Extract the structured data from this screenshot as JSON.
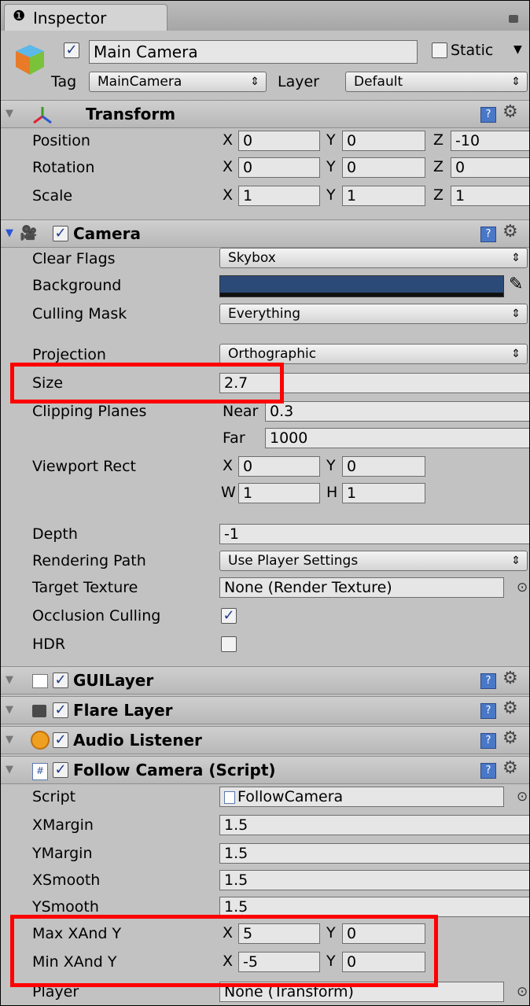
{
  "tab": {
    "title": "Inspector"
  },
  "object": {
    "name": "Main Camera",
    "static_label": "Static",
    "tag_label": "Tag",
    "tag_value": "MainCamera",
    "layer_label": "Layer",
    "layer_value": "Default"
  },
  "transform": {
    "title": "Transform",
    "rows": [
      {
        "label": "Position",
        "x": "0",
        "y": "0",
        "z": "-10"
      },
      {
        "label": "Rotation",
        "x": "0",
        "y": "0",
        "z": "0"
      },
      {
        "label": "Scale",
        "x": "1",
        "y": "1",
        "z": "1"
      }
    ]
  },
  "axes": {
    "x": "X",
    "y": "Y",
    "z": "Z",
    "w": "W",
    "h": "H"
  },
  "camera": {
    "title": "Camera",
    "clear_flags": {
      "label": "Clear Flags",
      "value": "Skybox"
    },
    "background": {
      "label": "Background",
      "color": "#2c4a78"
    },
    "culling_mask": {
      "label": "Culling Mask",
      "value": "Everything"
    },
    "projection": {
      "label": "Projection",
      "value": "Orthographic"
    },
    "size": {
      "label": "Size",
      "value": "2.7"
    },
    "clipping": {
      "label": "Clipping Planes",
      "near_label": "Near",
      "near": "0.3",
      "far_label": "Far",
      "far": "1000"
    },
    "viewport": {
      "label": "Viewport Rect",
      "x": "0",
      "y": "0",
      "w": "1",
      "h": "1"
    },
    "depth": {
      "label": "Depth",
      "value": "-1"
    },
    "rendering_path": {
      "label": "Rendering Path",
      "value": "Use Player Settings"
    },
    "target_texture": {
      "label": "Target Texture",
      "value": "None (Render Texture)"
    },
    "occlusion": {
      "label": "Occlusion Culling",
      "checked": true
    },
    "hdr": {
      "label": "HDR",
      "checked": false
    }
  },
  "components": {
    "gui_layer": "GUILayer",
    "flare_layer": "Flare Layer",
    "audio_listener": "Audio Listener"
  },
  "follow": {
    "title": "Follow Camera (Script)",
    "script": {
      "label": "Script",
      "value": "FollowCamera"
    },
    "xmargin": {
      "label": "XMargin",
      "value": "1.5"
    },
    "ymargin": {
      "label": "YMargin",
      "value": "1.5"
    },
    "xsmooth": {
      "label": "XSmooth",
      "value": "1.5"
    },
    "ysmooth": {
      "label": "YSmooth",
      "value": "1.5"
    },
    "max": {
      "label": "Max XAnd Y",
      "x": "5",
      "y": "0"
    },
    "min": {
      "label": "Min XAnd Y",
      "x": "-5",
      "y": "0"
    },
    "player": {
      "label": "Player",
      "value": "None (Transform)"
    }
  },
  "glyphs": {
    "check": "✓",
    "arrow": "⇕",
    "gear": "⚙",
    "help": "?",
    "picker": "⊙",
    "info": "❶",
    "lock": "🔒"
  }
}
